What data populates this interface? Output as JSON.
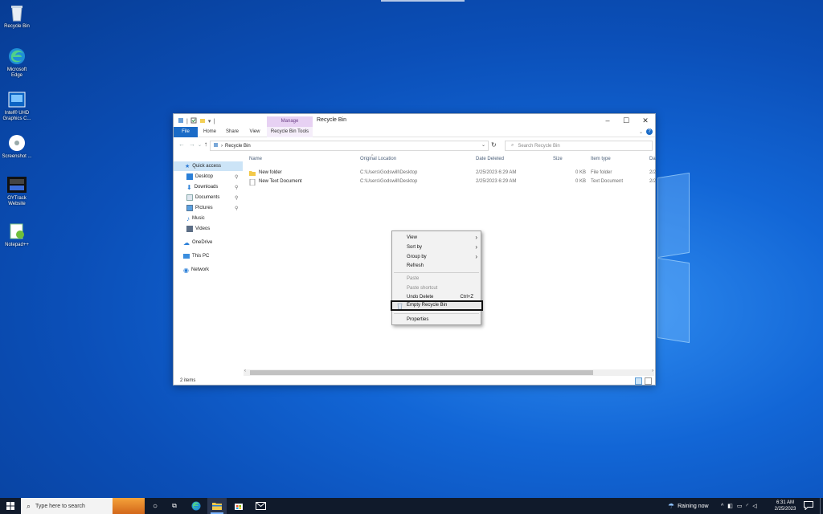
{
  "desktop": {
    "icons": [
      {
        "label": "Recycle Bin",
        "icon": "recycle-bin-icon"
      },
      {
        "label": "Microsoft Edge",
        "icon": "edge-icon"
      },
      {
        "label": "Intel® UHD Graphics C...",
        "icon": "intel-graphics-icon"
      },
      {
        "label": "Screenshot ...",
        "icon": "screenshot-icon"
      },
      {
        "label": "OYTrack Website",
        "icon": "oytrack-icon"
      },
      {
        "label": "Notepad++",
        "icon": "notepadpp-icon"
      }
    ]
  },
  "explorer": {
    "title": "Recycle Bin",
    "contextual_tab": "Manage",
    "contextual_tools": "Recycle Bin Tools",
    "tabs": [
      "File",
      "Home",
      "Share",
      "View"
    ],
    "address": "Recycle Bin",
    "search_placeholder": "Search Recycle Bin",
    "nav": {
      "quick_access": "Quick access",
      "items": [
        "Desktop",
        "Downloads",
        "Documents",
        "Pictures",
        "Music",
        "Videos"
      ],
      "onedrive": "OneDrive",
      "this_pc": "This PC",
      "network": "Network"
    },
    "columns": [
      "Name",
      "Original Location",
      "Date Deleted",
      "Size",
      "Item type",
      "Da"
    ],
    "rows": [
      {
        "name": "New folder",
        "location": "C:\\Users\\Godswill\\Desktop",
        "date": "2/25/2023 6:29 AM",
        "size": "0 KB",
        "type": "File folder",
        "extra": "2/2"
      },
      {
        "name": "New Text Document",
        "location": "C:\\Users\\Godswill\\Desktop",
        "date": "2/25/2023 6:29 AM",
        "size": "0 KB",
        "type": "Text Document",
        "extra": "2/2"
      }
    ],
    "status": "2 items"
  },
  "context_menu": {
    "view": "View",
    "sort_by": "Sort by",
    "group_by": "Group by",
    "refresh": "Refresh",
    "paste": "Paste",
    "paste_shortcut": "Paste shortcut",
    "undo_delete": "Undo Delete",
    "undo_shortcut": "Ctrl+Z",
    "empty_recycle_bin": "Empty Recycle Bin",
    "properties": "Properties"
  },
  "taskbar": {
    "search_placeholder": "Type here to search",
    "weather": "Raining now",
    "time": "6:31 AM",
    "date": "2/25/2023"
  },
  "colors": {
    "accent": "#1a6bc7",
    "manage_tab": "#e7d1f3",
    "taskbar": "#101a2b",
    "selection": "#cce4f7"
  }
}
